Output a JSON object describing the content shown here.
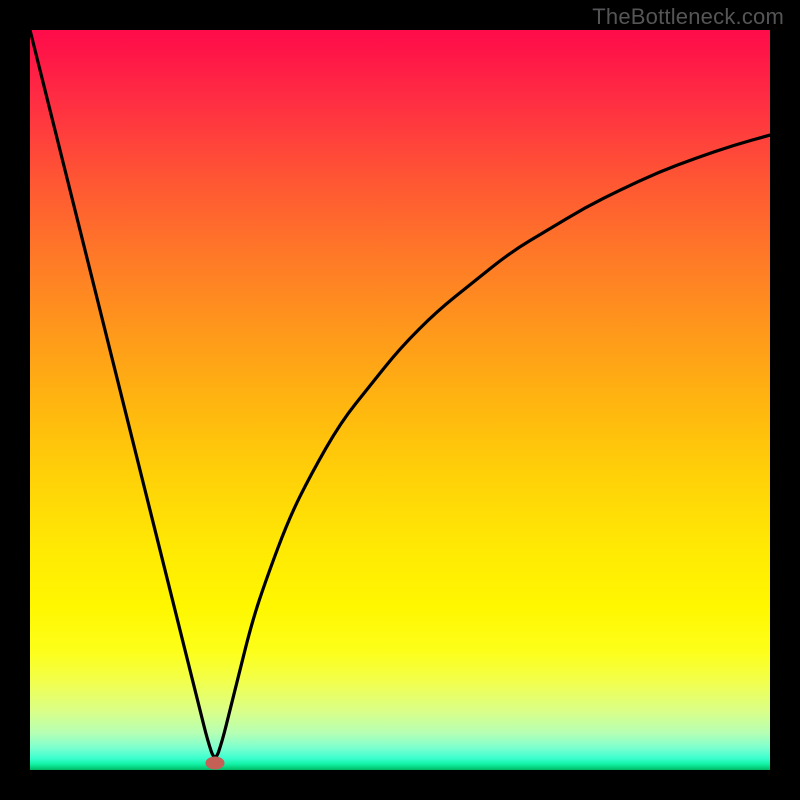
{
  "watermark": "TheBottleneck.com",
  "colors": {
    "curve_stroke": "#000000",
    "marker_fill": "#c46055",
    "frame_bg": "#000000"
  },
  "chart_data": {
    "type": "line",
    "title": "",
    "xlabel": "",
    "ylabel": "",
    "xlim": [
      0,
      100
    ],
    "ylim": [
      0,
      100
    ],
    "grid": false,
    "legend": false,
    "description": "V-shaped bottleneck curve (notch response) with minimum near x≈25. Left branch nearly linear descending from upper-left corner; right branch logarithmic-like approaching ~86 at the right edge.",
    "x": [
      0,
      2,
      4,
      6,
      8,
      10,
      12,
      14,
      16,
      18,
      20,
      22,
      23,
      24,
      25,
      26,
      27,
      28,
      30,
      32,
      35,
      38,
      42,
      46,
      50,
      55,
      60,
      65,
      70,
      75,
      80,
      85,
      90,
      95,
      100
    ],
    "y": [
      100,
      92,
      84,
      76,
      68,
      60,
      52,
      44,
      36,
      28,
      20,
      12,
      8,
      4,
      1,
      4,
      8,
      12,
      20,
      26,
      34,
      40,
      47,
      52,
      57,
      62,
      66,
      70,
      73,
      76,
      78.5,
      80.8,
      82.7,
      84.4,
      85.8
    ],
    "marker": {
      "x": 25,
      "y": 1
    },
    "gradient_note": "Background is a vertical spectral gradient: red (top) → orange → yellow → green (bottom), approximating a good-to-bad scale inverted vertically."
  }
}
